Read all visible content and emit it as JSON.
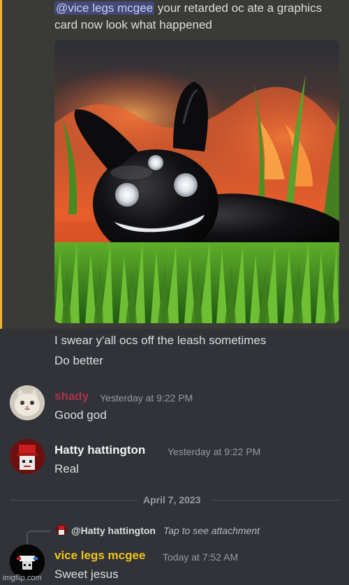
{
  "highlighted_message": {
    "mention": "@vice legs mcgee",
    "text_line1_rest": " your retarded oc ate a graphics",
    "text_line2": "card now look what happened",
    "attachment_description": "black glossy rabbit-eared slug creature in grass with fire"
  },
  "followups": [
    "I swear y'all ocs off the leash sometimes",
    "Do better"
  ],
  "messages": [
    {
      "username": "shady",
      "timestamp": "Yesterday at 9:22 PM",
      "text": "Good god",
      "name_color": "#a8324a"
    },
    {
      "username": "Hatty hattington",
      "timestamp": "Yesterday at 9:22 PM",
      "text": "Real",
      "name_color": "#f2f3f5"
    }
  ],
  "date_divider": "April 7, 2023",
  "reply": {
    "reply_to_name": "@Hatty hattington",
    "reply_to_text": "Tap to see attachment",
    "username": "vice legs mcgee",
    "timestamp": "Today at 7:52 AM",
    "text": "Sweet jesus",
    "name_color": "#f0c419"
  },
  "watermark": "imgflip.com",
  "colors": {
    "background": "#313338",
    "highlight_bar": "#f0b232",
    "mention_bg": "#5865f2"
  }
}
